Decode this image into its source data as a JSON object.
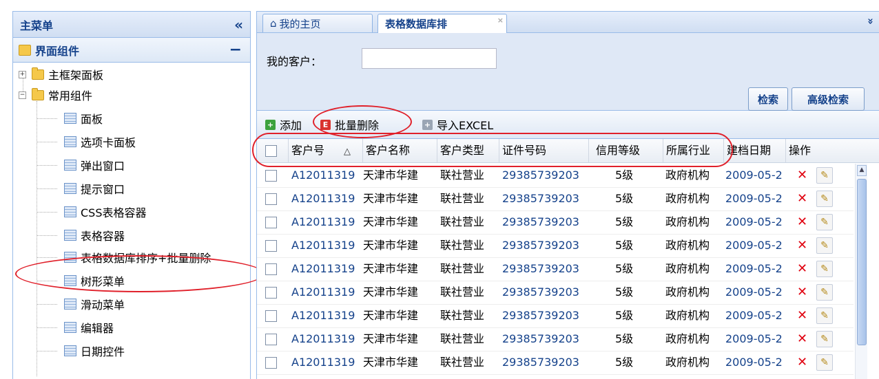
{
  "sidebar": {
    "title": "主菜单",
    "collapse_glyph": "«",
    "accordion_title": "界面组件",
    "accordion_toggle": "−",
    "tree": [
      {
        "label": "主框架面板",
        "toggle": "+"
      },
      {
        "label": "常用组件",
        "toggle": "−"
      }
    ],
    "leaves": [
      "面板",
      "选项卡面板",
      "弹出窗口",
      "提示窗口",
      "CSS表格容器",
      "表格容器",
      "表格数据库排序+批量删除",
      "树形菜单",
      "滑动菜单",
      "编辑器",
      "日期控件"
    ]
  },
  "tabs": [
    {
      "label": "我的主页",
      "icon": "home-icon"
    },
    {
      "label": "表格数据库排",
      "close": "×"
    }
  ],
  "overflow_glyph": "»",
  "search": {
    "label": "我的客户：",
    "value": "",
    "search_button": "检索",
    "advanced_button": "高级检索"
  },
  "toolbar": {
    "add": "添加",
    "batch_delete": "批量删除",
    "import": "导入EXCEL"
  },
  "grid": {
    "columns": [
      "客户号",
      "客户名称",
      "客户类型",
      "证件号码",
      "信用等级",
      "所属行业",
      "建档日期",
      "操作"
    ],
    "sort_glyph": "△",
    "rows": [
      {
        "id": "A12011319",
        "name": "天津市华建",
        "type": "联社营业",
        "cert": "29385739203",
        "credit": "5级",
        "industry": "政府机构",
        "date": "2009-05-2"
      },
      {
        "id": "A12011319",
        "name": "天津市华建",
        "type": "联社营业",
        "cert": "29385739203",
        "credit": "5级",
        "industry": "政府机构",
        "date": "2009-05-2"
      },
      {
        "id": "A12011319",
        "name": "天津市华建",
        "type": "联社营业",
        "cert": "29385739203",
        "credit": "5级",
        "industry": "政府机构",
        "date": "2009-05-2"
      },
      {
        "id": "A12011319",
        "name": "天津市华建",
        "type": "联社营业",
        "cert": "29385739203",
        "credit": "5级",
        "industry": "政府机构",
        "date": "2009-05-2"
      },
      {
        "id": "A12011319",
        "name": "天津市华建",
        "type": "联社营业",
        "cert": "29385739203",
        "credit": "5级",
        "industry": "政府机构",
        "date": "2009-05-2"
      },
      {
        "id": "A12011319",
        "name": "天津市华建",
        "type": "联社营业",
        "cert": "29385739203",
        "credit": "5级",
        "industry": "政府机构",
        "date": "2009-05-2"
      },
      {
        "id": "A12011319",
        "name": "天津市华建",
        "type": "联社营业",
        "cert": "29385739203",
        "credit": "5级",
        "industry": "政府机构",
        "date": "2009-05-2"
      },
      {
        "id": "A12011319",
        "name": "天津市华建",
        "type": "联社营业",
        "cert": "29385739203",
        "credit": "5级",
        "industry": "政府机构",
        "date": "2009-05-2"
      },
      {
        "id": "A12011319",
        "name": "天津市华建",
        "type": "联社营业",
        "cert": "29385739203",
        "credit": "5级",
        "industry": "政府机构",
        "date": "2009-05-2"
      }
    ],
    "delete_glyph": "✕",
    "edit_glyph": "✎"
  },
  "colors": {
    "accent": "#15428b",
    "border": "#99bbe8",
    "highlight": "#e0202a"
  }
}
